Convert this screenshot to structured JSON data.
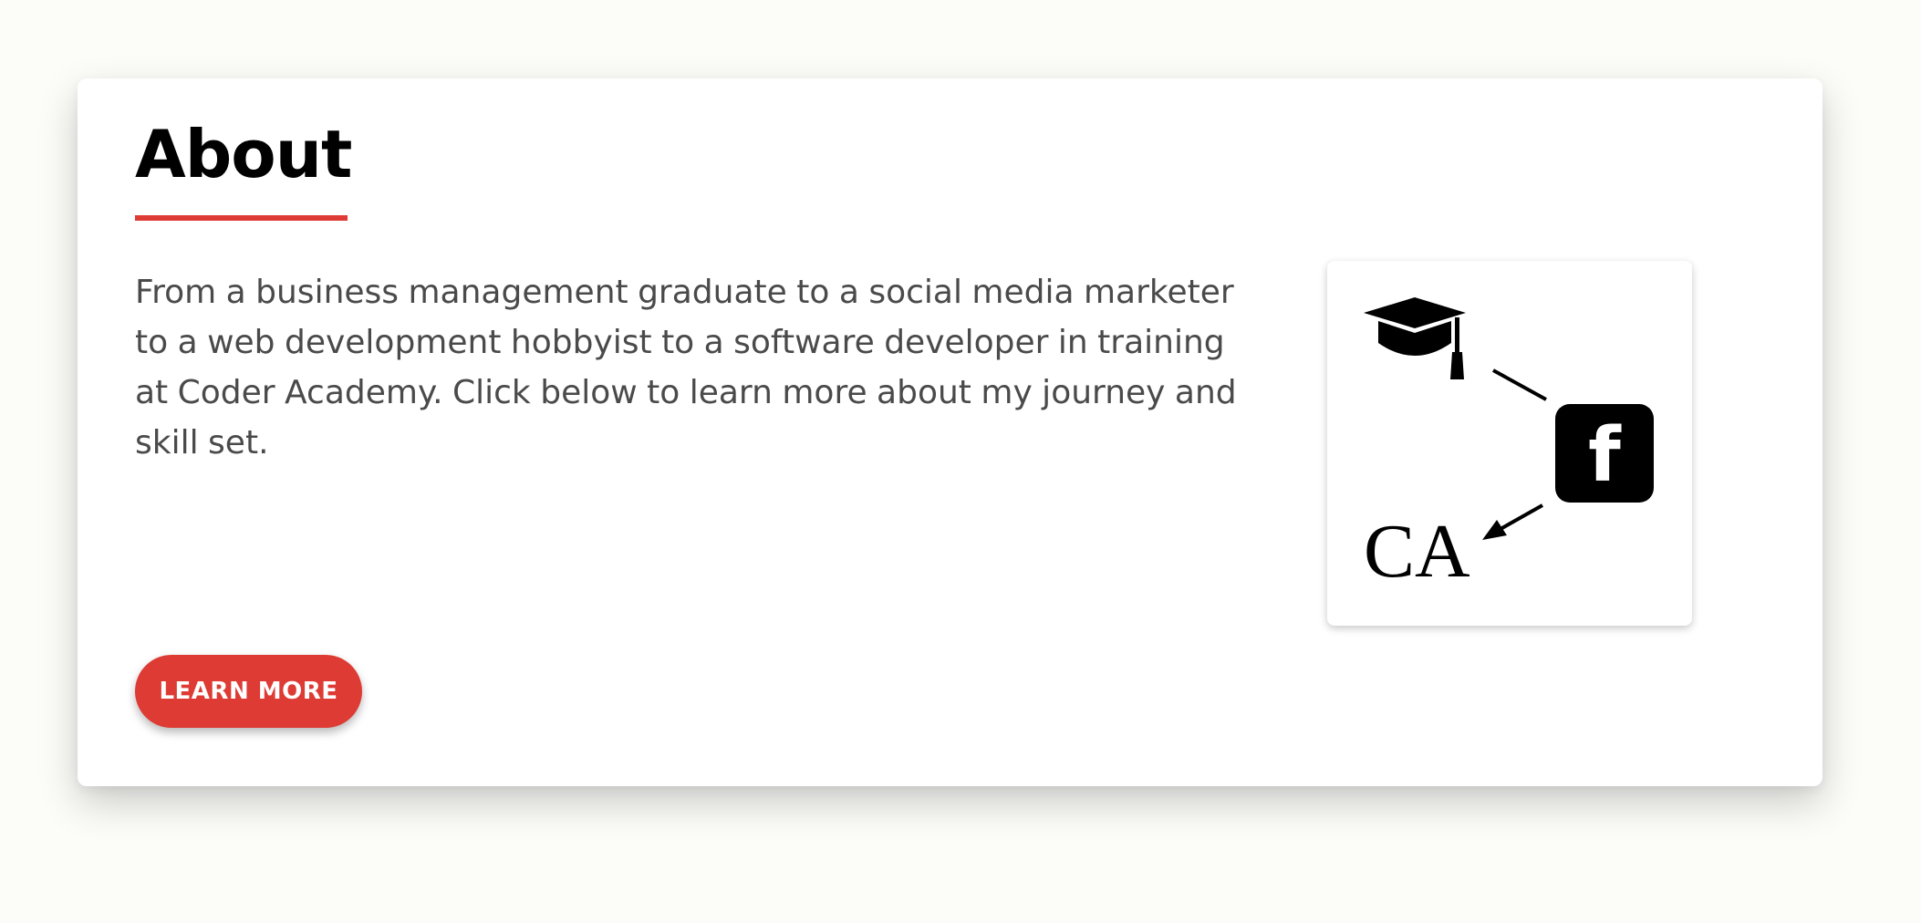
{
  "about": {
    "title": "About",
    "description": "From a business management graduate to a social media marketer to a web development hobbyist to a software developer in training at Coder Academy. Click below to learn more about my journey and skill set.",
    "button_label": "LEARN MORE",
    "accent_color": "#dd3b34"
  },
  "journey_image": {
    "icons": [
      "graduation-cap-icon",
      "facebook-icon",
      "coder-academy-logo"
    ],
    "logo_text": "CA",
    "facebook_glyph": "f"
  }
}
